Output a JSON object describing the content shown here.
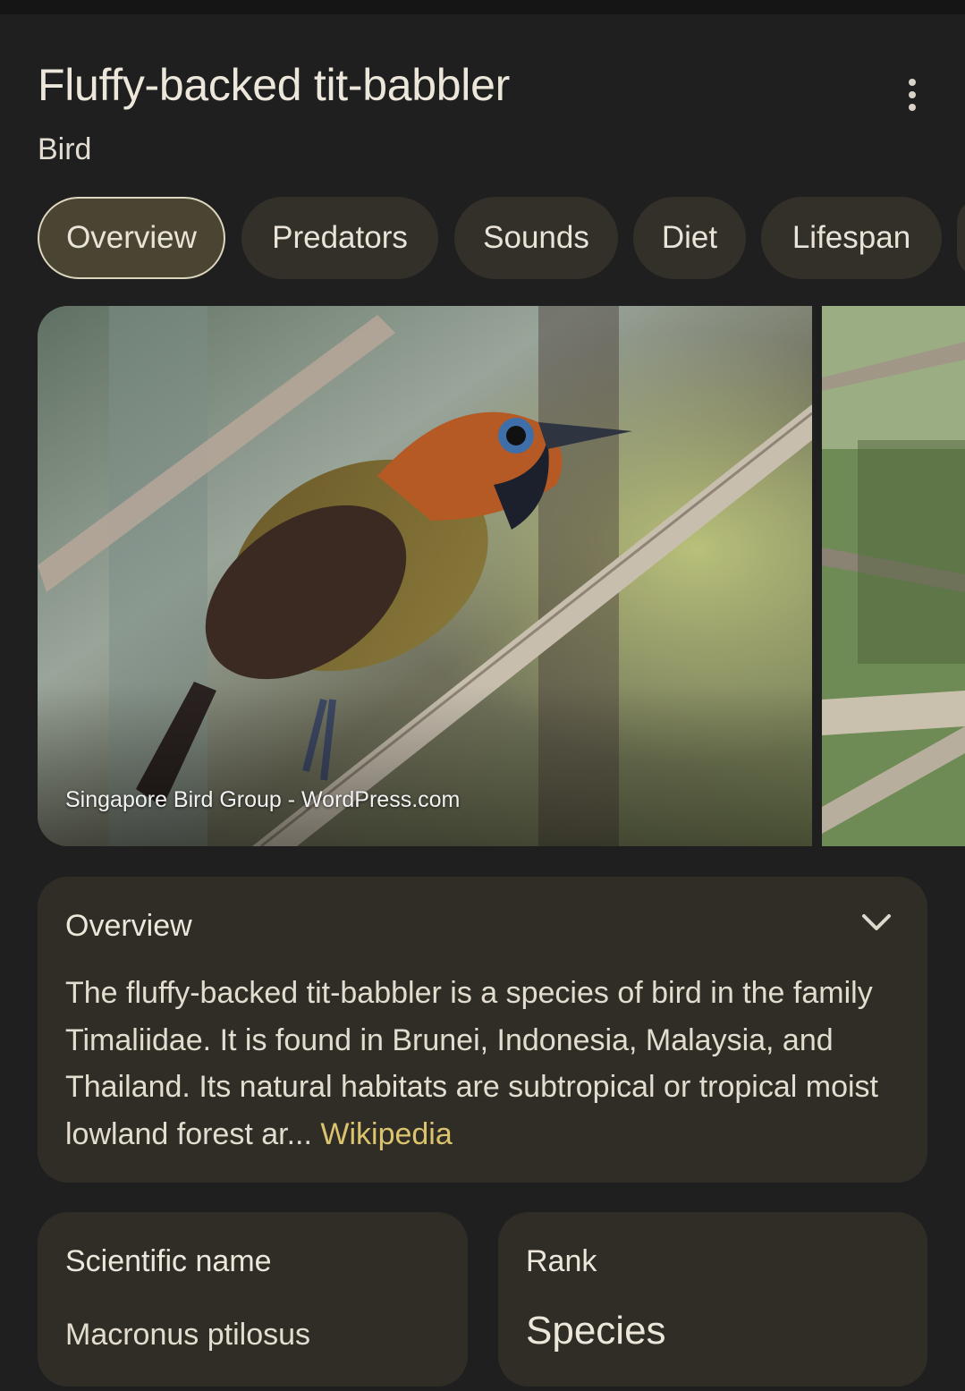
{
  "header": {
    "title": "Fluffy-backed tit-babbler",
    "subtitle": "Bird",
    "more_icon": "more-vert-icon"
  },
  "tabs": [
    {
      "label": "Overview",
      "active": true
    },
    {
      "label": "Predators",
      "active": false
    },
    {
      "label": "Sounds",
      "active": false
    },
    {
      "label": "Diet",
      "active": false
    },
    {
      "label": "Lifespan",
      "active": false
    }
  ],
  "images": {
    "main_caption": "Singapore Bird Group - WordPress.com"
  },
  "overview": {
    "heading": "Overview",
    "text": "The fluffy-backed tit-babbler is a species of bird in the family Timaliidae. It is found in Brunei, Indonesia, Malaysia, and Thailand. Its natural habitats are subtropical or tropical moist lowland forest ar...",
    "source_link": "Wikipedia",
    "expand_icon": "chevron-down-icon"
  },
  "facts": [
    {
      "label": "Scientific name",
      "value": "Macronus ptilosus"
    },
    {
      "label": "Rank",
      "value": "Species"
    }
  ],
  "colors": {
    "background": "#1f1f1f",
    "card": "#302d27",
    "chip": "#33302a",
    "chip_active": "#4a4533",
    "link": "#dcc46d"
  }
}
